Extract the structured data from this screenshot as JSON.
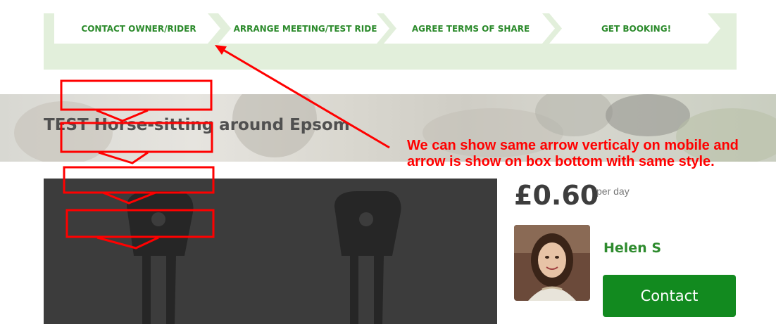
{
  "steps": [
    {
      "label": "CONTACT OWNER/RIDER"
    },
    {
      "label": "ARRANGE MEETING/TEST RIDE"
    },
    {
      "label": "AGREE TERMS OF SHARE"
    },
    {
      "label": "GET BOOKING!"
    }
  ],
  "listing": {
    "title": "TEST Horse-sitting around Epsom",
    "price": "£0.60",
    "price_unit": "per day",
    "owner_name": "Helen S",
    "contact_label": "Contact"
  },
  "annotation": {
    "line1": "We can show same arrow verticaly on mobile and",
    "line2": "arrow is show on box bottom with same style."
  },
  "colors": {
    "steps_background": "#e2efdb",
    "step_text": "#2b8a2b",
    "contact_button": "#128a1f",
    "owner_name": "#2e8b2e",
    "annotation": "#ff0000"
  },
  "icons": {
    "image_placeholder": "horseshoe-placeholder-icon"
  }
}
